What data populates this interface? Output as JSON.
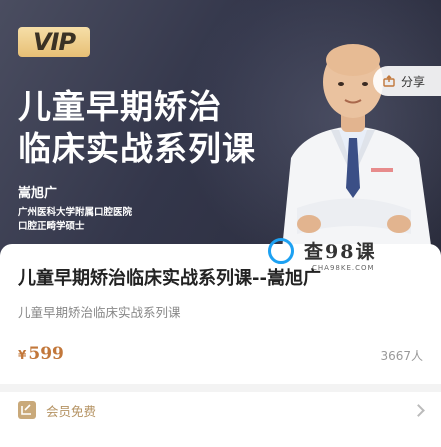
{
  "banner": {
    "vip_badge": "VIP",
    "title_line1": "儿童早期矫治",
    "title_line2": "临床实战系列课",
    "teacher_name": "嵩旭广",
    "teacher_desc_line1": "广州医科大学附属口腔医院",
    "teacher_desc_line2": "口腔正畸学硕士"
  },
  "share": {
    "label": "分享"
  },
  "course": {
    "title": "儿童早期矫治临床实战系列课--嵩旭广",
    "subtitle": "儿童早期矫治临床实战系列课",
    "currency": "¥",
    "price": "599",
    "enrolled": "3667人"
  },
  "watermark": {
    "text": "查98课",
    "domain": "CHA98KE.COM"
  },
  "member": {
    "label": "会员免费"
  },
  "colors": {
    "accent": "#c2773a",
    "vip_gold": "#e7bf75",
    "banner_bg": "#33364a"
  }
}
